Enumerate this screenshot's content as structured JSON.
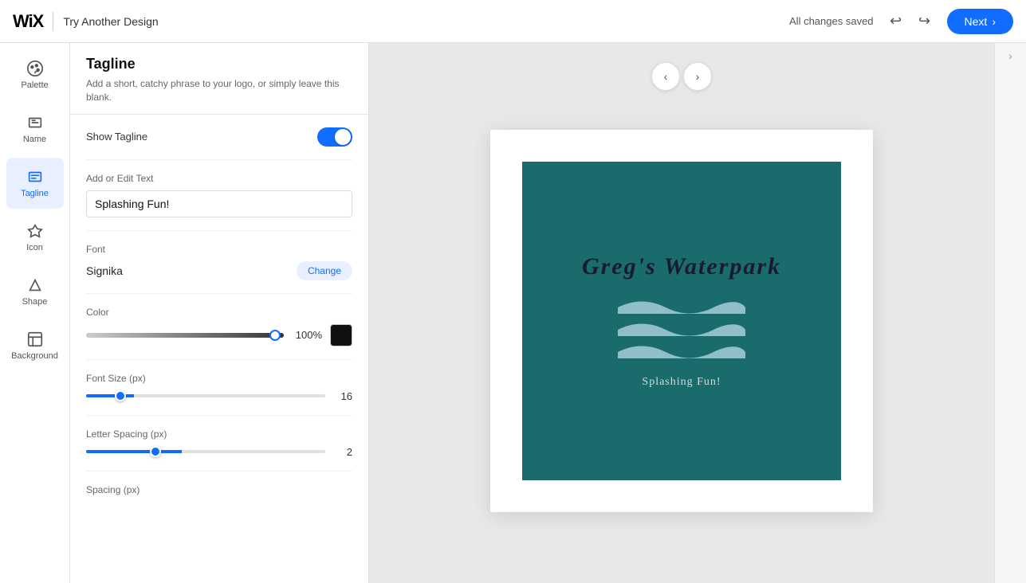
{
  "header": {
    "logo": "WiX",
    "title": "Try Another Design",
    "status": "All changes saved",
    "next_label": "Next"
  },
  "sidebar": {
    "items": [
      {
        "id": "palette",
        "label": "Palette",
        "active": false
      },
      {
        "id": "name",
        "label": "Name",
        "active": false
      },
      {
        "id": "tagline",
        "label": "Tagline",
        "active": true
      },
      {
        "id": "icon",
        "label": "Icon",
        "active": false
      },
      {
        "id": "shape",
        "label": "Shape",
        "active": false
      },
      {
        "id": "background",
        "label": "Background",
        "active": false
      }
    ]
  },
  "panel": {
    "title": "Tagline",
    "description": "Add a short, catchy phrase to your logo, or simply leave this blank.",
    "show_tagline_label": "Show Tagline",
    "show_tagline_on": true,
    "add_edit_text_label": "Add or Edit Text",
    "tagline_text": "Splashing Fun!",
    "font_label": "Font",
    "font_name": "Signika",
    "change_btn_label": "Change",
    "color_label": "Color",
    "color_percent": "100%",
    "font_size_label": "Font Size (px)",
    "font_size_value": "16",
    "letter_spacing_label": "Letter Spacing (px)",
    "letter_spacing_value": "2",
    "spacing_label": "Spacing (px)"
  },
  "logo": {
    "title": "Greg's Waterpark",
    "tagline": "Splashing Fun!",
    "bg_color": "#1a6b6b"
  }
}
